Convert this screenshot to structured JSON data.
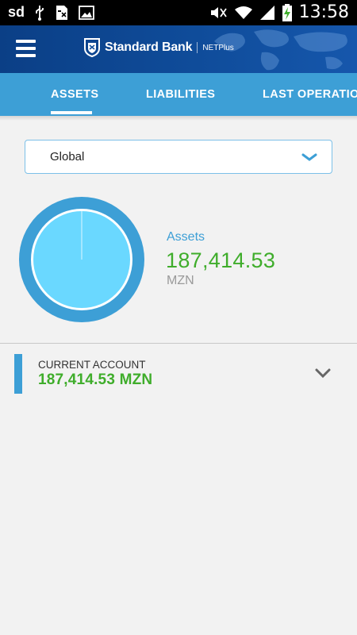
{
  "status_bar": {
    "carrier": "sd",
    "time": "13:58",
    "left_icons": [
      "usb-icon",
      "sim-card-icon",
      "image-icon"
    ],
    "right_icons": [
      "mute-icon",
      "wifi-icon",
      "signal-icon",
      "battery-charging-icon"
    ]
  },
  "header": {
    "menu_icon": "hamburger-menu-icon",
    "brand_name": "Standard Bank",
    "brand_product": "NETPlus",
    "brand_color": "#0f4c9a"
  },
  "tabs": [
    {
      "label": "ASSETS",
      "active": true
    },
    {
      "label": "LIABILITIES",
      "active": false
    },
    {
      "label": "LAST OPERATION",
      "active": false
    }
  ],
  "filter": {
    "selected": "Global"
  },
  "summary": {
    "label": "Assets",
    "amount": "187,414.53",
    "currency": "MZN",
    "accent_color": "#3d9fd6",
    "amount_color": "#3fad2b"
  },
  "chart_data": {
    "type": "pie",
    "slices": [
      {
        "label": "CURRENT ACCOUNT",
        "value": 187414.53,
        "color": "#6ad8ff"
      }
    ]
  },
  "accounts": [
    {
      "name": "CURRENT ACCOUNT",
      "amount": "187,414.53 MZN",
      "color": "#3d9fd6"
    }
  ]
}
